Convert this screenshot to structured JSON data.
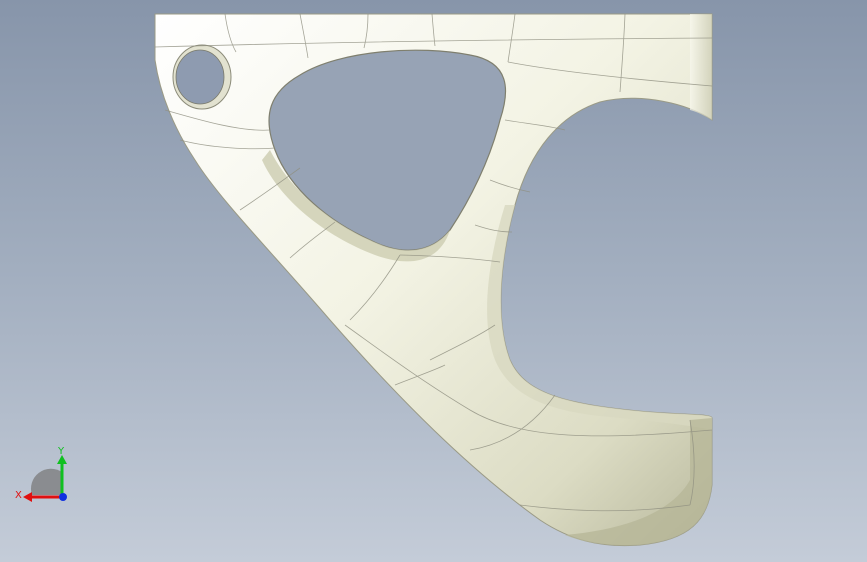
{
  "viewport": {
    "background_top": "#8795aa",
    "background_bottom": "#c4ccd8"
  },
  "model": {
    "surface_color": "#f4f4e6",
    "shade_color": "#b9b99a",
    "edge_color": "#8c8c7a"
  },
  "triad": {
    "x_label": "X",
    "y_label": "Y",
    "x_color": "#e01010",
    "y_color": "#10c020",
    "z_color": "#1030e0"
  }
}
